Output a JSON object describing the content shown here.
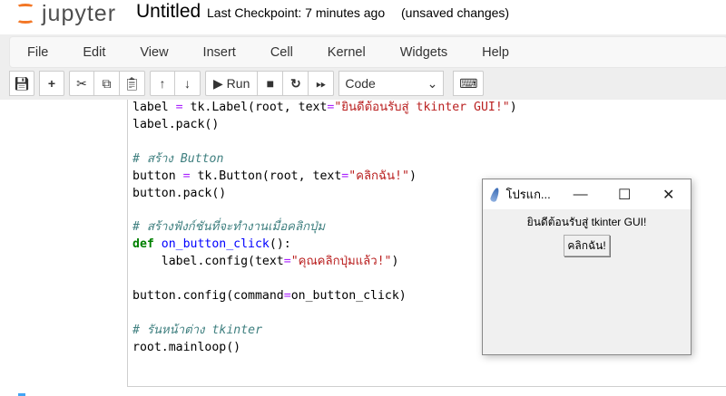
{
  "header": {
    "logo": "jupyter",
    "title": "Untitled",
    "checkpoint": "Last Checkpoint: 7 minutes ago",
    "status": "(unsaved changes)"
  },
  "menu": [
    "File",
    "Edit",
    "View",
    "Insert",
    "Cell",
    "Kernel",
    "Widgets",
    "Help"
  ],
  "toolbar": {
    "run_label": "Run",
    "cell_type": "Code"
  },
  "code": {
    "l0a": "label ",
    "l0b": "=",
    "l0c": " tk.Label(root, text",
    "l0d": "=",
    "l0e": "\"ยินดีต้อนรับสู่ tkinter GUI!\"",
    "l0f": ")",
    "l1": "label.pack()",
    "c1": "# สร้าง Button",
    "l3a": "button ",
    "l3b": "=",
    "l3c": " tk.Button(root, text",
    "l3d": "=",
    "l3e": "\"คลิกฉัน!\"",
    "l3f": ")",
    "l4": "button.pack()",
    "c2": "# สร้างฟังก์ชันที่จะทำงานเมื่อคลิกปุ่ม",
    "l7a": "def",
    "l7b": "on_button_click",
    "l7c": "():",
    "l8a": "    label.config(text",
    "l8b": "=",
    "l8c": "\"คุณคลิกปุ่มแล้ว!\"",
    "l8d": ")",
    "l10a": "button.config(command",
    "l10b": "=",
    "l10c": "on_button_click)",
    "c3": "# รันหน้าต่าง tkinter",
    "l12": "root.mainloop()"
  },
  "tk_window": {
    "title": "โปรแก...",
    "label": "ยินดีต้อนรับสู่ tkinter GUI!",
    "button": "คลิกฉัน!"
  }
}
